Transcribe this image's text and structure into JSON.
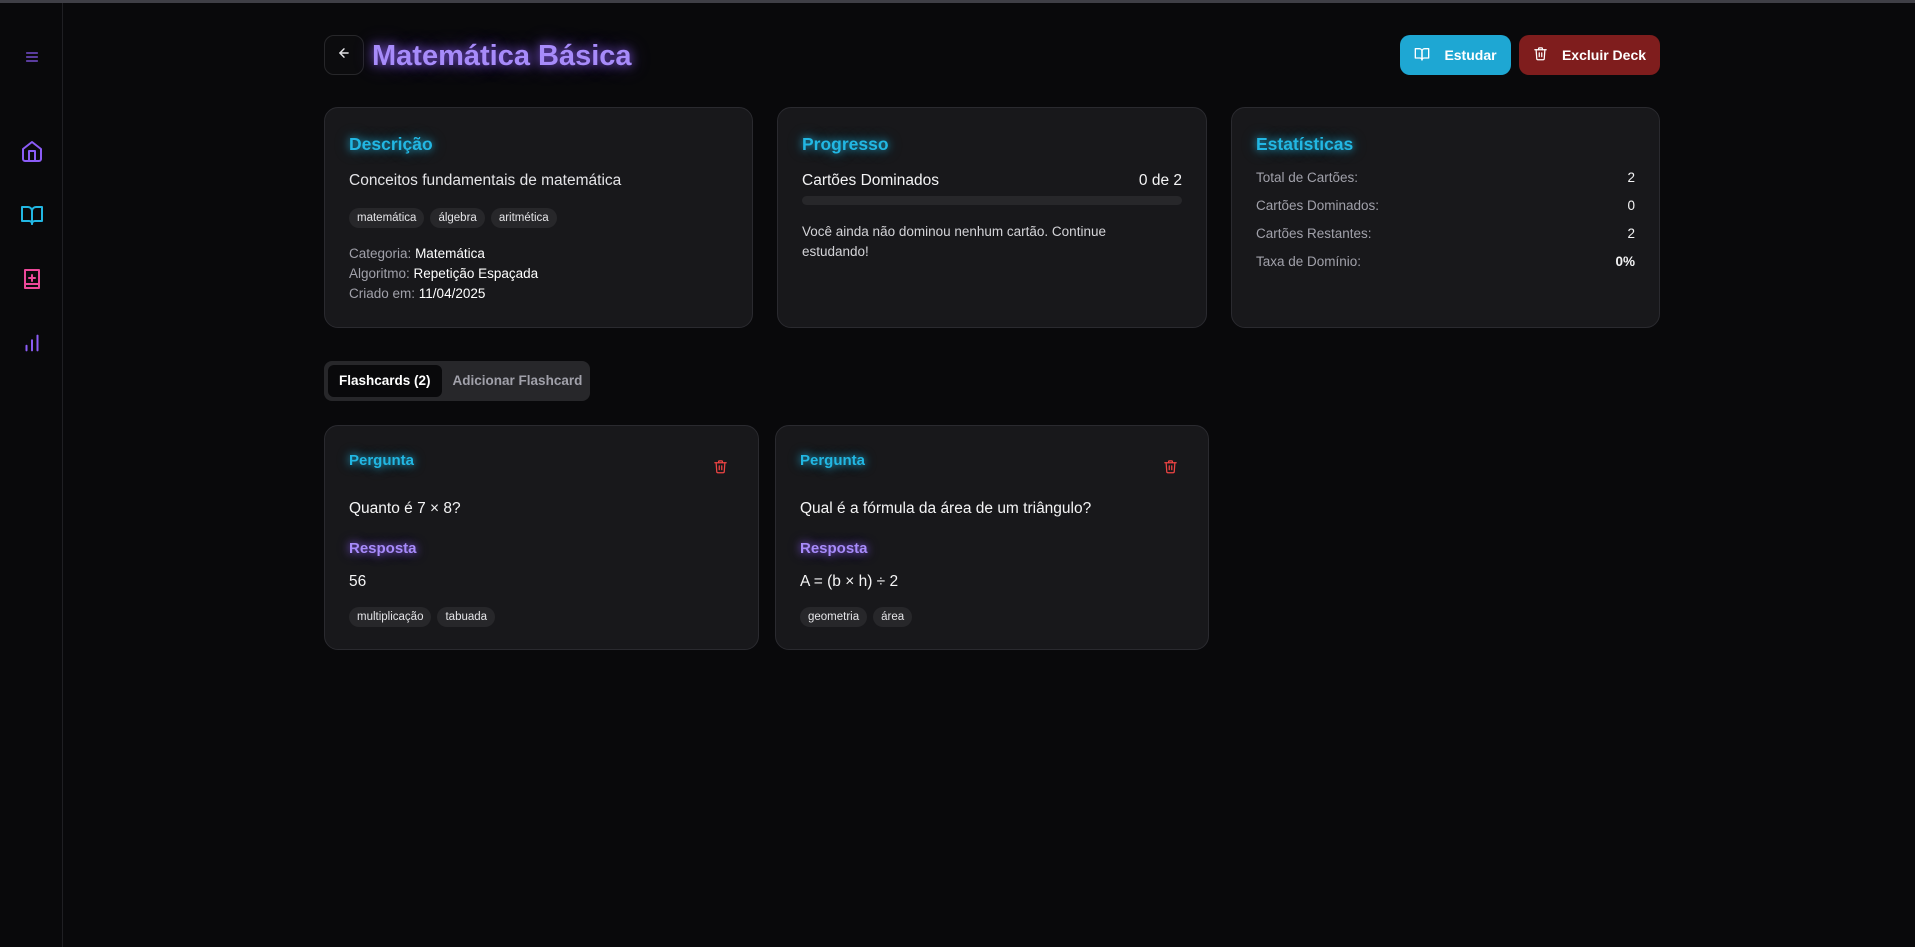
{
  "page": {
    "title": "Matemática Básica"
  },
  "sidebar": {
    "items": [
      {
        "name": "menu-icon"
      },
      {
        "name": "home-icon"
      },
      {
        "name": "book-open-icon"
      },
      {
        "name": "book-plus-icon"
      },
      {
        "name": "bar-chart-icon"
      }
    ]
  },
  "header": {
    "study_label": "Estudar",
    "delete_label": "Excluir Deck"
  },
  "description": {
    "title": "Descrição",
    "text": "Conceitos fundamentais de matemática",
    "tags": [
      "matemática",
      "álgebra",
      "aritmética"
    ],
    "category_label": "Categoria:",
    "category_value": "Matemática",
    "algorithm_label": "Algoritmo:",
    "algorithm_value": "Repetição Espaçada",
    "created_label": "Criado em:",
    "created_value": "11/04/2025"
  },
  "progress": {
    "title": "Progresso",
    "label": "Cartões Dominados",
    "count_text": "0 de 2",
    "fraction": 0,
    "note": "Você ainda não dominou nenhum cartão. Continue estudando!"
  },
  "statistics": {
    "title": "Estatísticas",
    "rows": [
      {
        "label": "Total de Cartões:",
        "value": "2"
      },
      {
        "label": "Cartões Dominados:",
        "value": "0"
      },
      {
        "label": "Cartões Restantes:",
        "value": "2"
      },
      {
        "label": "Taxa de Domínio:",
        "value": "0%"
      }
    ]
  },
  "tabs": [
    {
      "label": "Flashcards (2)",
      "active": true
    },
    {
      "label": "Adicionar Flashcard",
      "active": false
    }
  ],
  "flashcards": [
    {
      "question_label": "Pergunta",
      "question": "Quanto é 7 × 8?",
      "answer_label": "Resposta",
      "answer": "56",
      "tags": [
        "multiplicação",
        "tabuada"
      ]
    },
    {
      "question_label": "Pergunta",
      "question": "Qual é a fórmula da área de um triângulo?",
      "answer_label": "Resposta",
      "answer": "A = (b × h) ÷ 2",
      "tags": [
        "geometria",
        "área"
      ]
    }
  ],
  "colors": {
    "background": "#09090b",
    "card": "#18181b",
    "accent_cyan": "#22b7e3",
    "accent_purple": "#a78bfa",
    "accent_pink": "#ec4899",
    "study_button": "#1ea7d3",
    "delete_button": "#7f1d1d",
    "danger_icon": "#ef4444"
  }
}
